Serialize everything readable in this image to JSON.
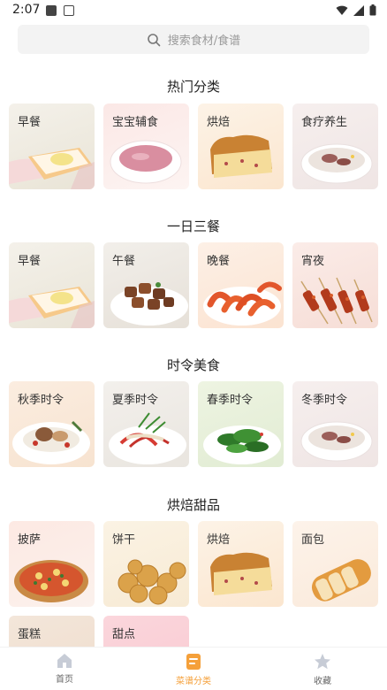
{
  "status_bar": {
    "time": "2:07"
  },
  "search": {
    "placeholder": "搜索食材/食谱"
  },
  "sections": [
    {
      "title": "热门分类",
      "items": [
        "早餐",
        "宝宝辅食",
        "烘焙",
        "食疗养生"
      ]
    },
    {
      "title": "一日三餐",
      "items": [
        "早餐",
        "午餐",
        "晚餐",
        "宵夜"
      ]
    },
    {
      "title": "时令美食",
      "items": [
        "秋季时令",
        "夏季时令",
        "春季时令",
        "冬季时令"
      ]
    },
    {
      "title": "烘焙甜品",
      "items": [
        "披萨",
        "饼干",
        "烘焙",
        "面包",
        "蛋糕",
        "甜点"
      ]
    }
  ],
  "bottom_nav": {
    "items": [
      {
        "label": "首页",
        "icon": "home-icon",
        "active": false
      },
      {
        "label": "菜谱分类",
        "icon": "recipe-category-icon",
        "active": true
      },
      {
        "label": "收藏",
        "icon": "star-icon",
        "active": false
      }
    ]
  },
  "colors": {
    "accent": "#f5a03a",
    "inactive": "#9aa0a6",
    "search_bg": "#f3f3f3"
  }
}
